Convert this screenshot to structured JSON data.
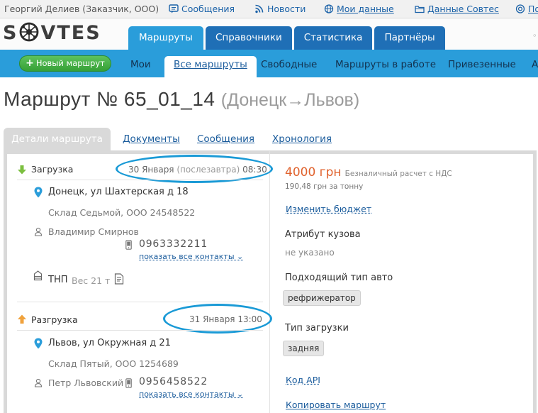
{
  "topbar": {
    "user": "Георгий Делиев (Заказчик, ООО)",
    "links": [
      "Сообщения",
      "Новости",
      "Мои данные",
      "Данные Совтес",
      "По"
    ]
  },
  "header": {
    "logo": "SOVTES",
    "logo_parts": {
      "left": "S",
      "right": "VTES"
    },
    "tabs": [
      "Маршруты",
      "Справочники",
      "Статистика",
      "Партнёры"
    ],
    "active_tab": "Маршруты"
  },
  "subnav": {
    "new_route": "Новый маршрут",
    "items": [
      "Мои",
      "Все маршруты",
      "Свободные",
      "Маршруты в работе",
      "Привезенные",
      "А"
    ],
    "active_item": "Все маршруты"
  },
  "route": {
    "title": "Маршрут № 65_01_14",
    "direction": "(Донецк→Львов)"
  },
  "detail_tabs": [
    "Детали маршрута",
    "Документы",
    "Сообщения",
    "Хронология"
  ],
  "loading": {
    "label": "Загрузка",
    "date": "30 Января",
    "date_note": "(послезавтра)",
    "time": "08:30",
    "address": "Донецк, ул Шахтерская д 18",
    "company": "Склад Седьмой, ООО 24548522",
    "contact": "Владимир Смирнов",
    "phone": "0963332211",
    "show_contacts": "показать все контакты",
    "cargo": "ТНП",
    "weight": "Вес 21 т"
  },
  "unloading": {
    "label": "Разгрузка",
    "datetime": "31 Января 13:00",
    "address": "Львов, ул Окружная д 21",
    "company": "Склад Пятый, ООО 1254689",
    "contact": "Петр Львовский",
    "phone": "0956458522",
    "show_contacts": "показать все контакты"
  },
  "budget": {
    "price": "4000 грн",
    "payment": "Безналичный расчет с НДС",
    "per_ton": "190,48 грн за тонну",
    "change_link": "Изменить бюджет"
  },
  "attributes": {
    "body_label": "Атрибут кузова",
    "body_value": "не указано",
    "vehicle_label": "Подходящий тип авто",
    "vehicle_value": "рефрижератор",
    "loading_label": "Тип загрузки",
    "loading_value": "задняя",
    "api_link": "Код API",
    "copy_link": "Копировать маршрут"
  },
  "colors": {
    "brand_blue": "#1f6fb6",
    "accent_blue": "#2a9dda",
    "green_button": "#36a036",
    "price_orange": "#e0622d",
    "highlight_oval": "#1a9ad6"
  }
}
